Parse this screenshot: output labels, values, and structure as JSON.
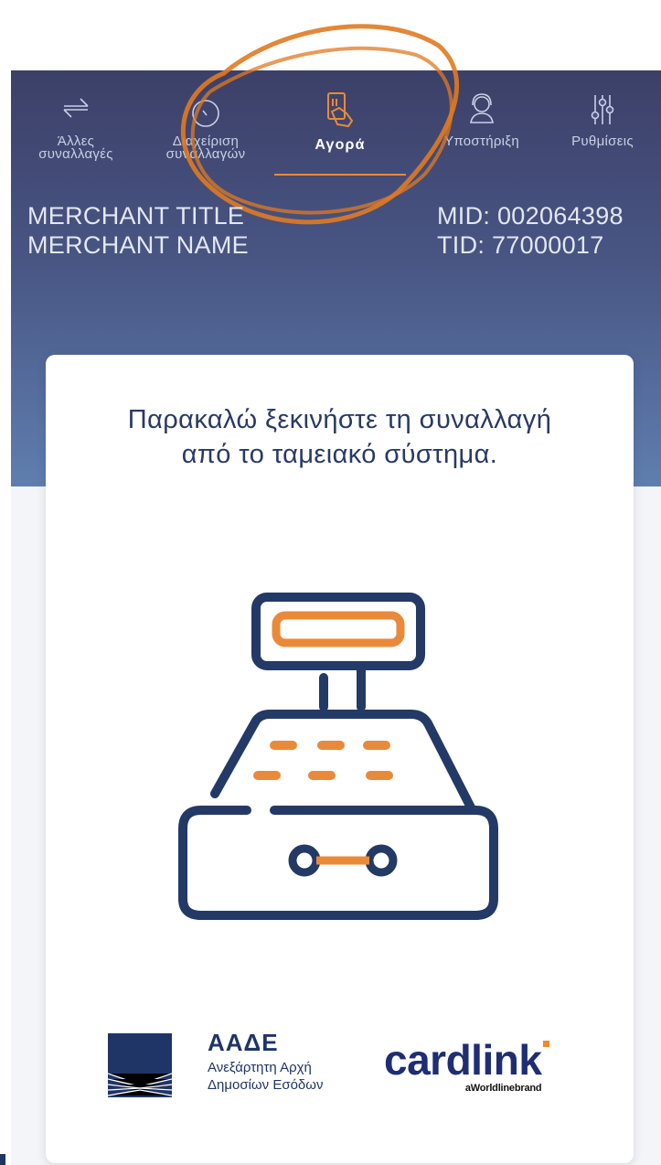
{
  "nav": {
    "items": [
      {
        "label": "Άλλες\nσυναλλαγές",
        "icon": "arrows-exchange-icon"
      },
      {
        "label": "Διαχείριση\nσυναλλαγών",
        "icon": "clock-icon"
      },
      {
        "label": "Αγορά",
        "icon": "card-hand-icon",
        "active": true
      },
      {
        "label": "Υποστήριξη",
        "icon": "headset-support-icon"
      },
      {
        "label": "Ρυθμίσεις",
        "icon": "sliders-icon"
      }
    ]
  },
  "merchant": {
    "title": "MERCHANT TITLE",
    "name": "MERCHANT NAME",
    "mid": "MID: 002064398",
    "tid": "TID: 77000017"
  },
  "card": {
    "message_line1": "Παρακαλώ ξεκινήστε τη συναλλαγή",
    "message_line2": "από το ταμειακό σύστημα.",
    "illustration": "cash-register-icon"
  },
  "logos": {
    "aade_title": "ΑΑΔΕ",
    "aade_sub1": "Ανεξάρτητη Αρχή",
    "aade_sub2": "Δημοσίων Εσόδων",
    "cardlink_word": "cardlink",
    "cardlink_tag": "aWorldlinebrand"
  },
  "colors": {
    "header_top": "#3c4068",
    "header_bottom": "#5f7eaf",
    "accent": "#e98a3a",
    "navy": "#233a66"
  }
}
